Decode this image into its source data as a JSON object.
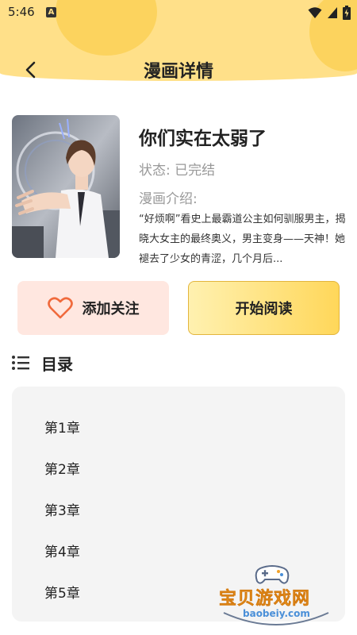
{
  "status_bar": {
    "time": "5:46",
    "notif_letter": "A"
  },
  "header": {
    "title": "漫画详情"
  },
  "comic": {
    "title": "你们实在太弱了",
    "status": "状态:  已完结",
    "intro_label": "漫画介绍:",
    "intro_text": "“好烦啊”看史上最霸道公主如何驯服男主，揭晓大女主的最终奥义，男主变身——天神！她褪去了少女的青涩，几个月后..."
  },
  "actions": {
    "follow_label": "添加关注",
    "read_label": "开始阅读"
  },
  "catalog": {
    "title": "目录",
    "chapters": [
      "第1章",
      "第2章",
      "第3章",
      "第4章",
      "第5章"
    ]
  },
  "watermark": {
    "text": "宝贝游戏网",
    "url": "baobeiy.com"
  },
  "colors": {
    "accent": "#ffe089",
    "button_gold": "#ffd75a",
    "follow_bg": "#ffe7e0",
    "heart": "#f06a3c"
  }
}
